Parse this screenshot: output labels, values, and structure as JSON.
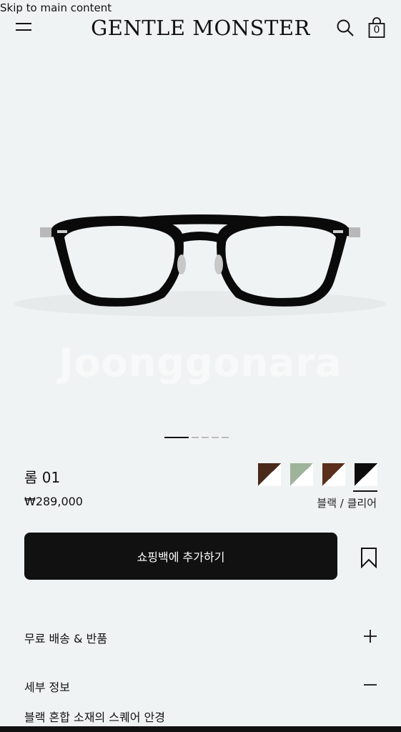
{
  "skip_link": "Skip to main content",
  "header": {
    "brand": "GENTLE MONSTER",
    "bag_count": "0",
    "icons": [
      "hamburger-menu-icon",
      "search-icon",
      "shopping-bag-icon"
    ]
  },
  "gallery": {
    "watermark": "Joonggonara",
    "slide_count": 5,
    "active_slide": 1
  },
  "product": {
    "name": "롬 01",
    "price": "₩289,000",
    "selected_color": "블랙 / 클리어",
    "swatches": [
      {
        "top": "#4a2a1a",
        "bottom": "#ffffff"
      },
      {
        "top": "#9fb39a",
        "bottom": "#ffffff"
      },
      {
        "top": "#5a2f1c",
        "bottom": "#ffffff"
      },
      {
        "top": "#0d0d0d",
        "bottom": "#ffffff"
      }
    ],
    "add_to_bag": "쇼핑백에 추가하기"
  },
  "accordion": {
    "shipping_label": "무료 배송 & 반품",
    "details_label": "세부 정보",
    "details_text": "블랙 혼합 소재의 스퀘어 안경"
  }
}
